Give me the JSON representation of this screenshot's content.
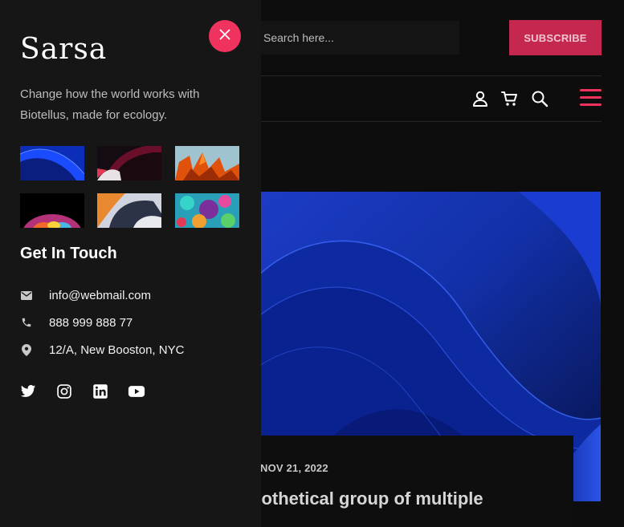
{
  "header": {
    "search_placeholder": "Search here...",
    "subscribe_label": "SUBSCRIBE"
  },
  "nav_icons": [
    "user-icon",
    "cart-icon",
    "search-icon",
    "hamburger-menu-icon"
  ],
  "article": {
    "date": "NOV 21, 2022",
    "title_visible": "pothetical group of multiple"
  },
  "side_panel": {
    "logo_text": "Sarsa",
    "tagline": "Change how the world works with Biotellus, made for ecology.",
    "gallery": [
      "blue-waves",
      "dark-abstract",
      "orange-petals",
      "colorful-sphere",
      "soft-3d-shapes",
      "coral-particles"
    ],
    "contact_title": "Get In Touch",
    "contacts": [
      {
        "icon": "mail-icon",
        "text": "info@webmail.com"
      },
      {
        "icon": "phone-icon",
        "text": "888 999 888 77"
      },
      {
        "icon": "location-pin-icon",
        "text": "12/A, New Booston, NYC"
      }
    ],
    "social": [
      "twitter-icon",
      "instagram-icon",
      "linkedin-icon",
      "youtube-icon"
    ]
  },
  "colors": {
    "accent": "#f0335e",
    "subscribe_bg": "#c4284f",
    "panel_bg": "#161616",
    "page_bg": "#0d0d0d"
  }
}
